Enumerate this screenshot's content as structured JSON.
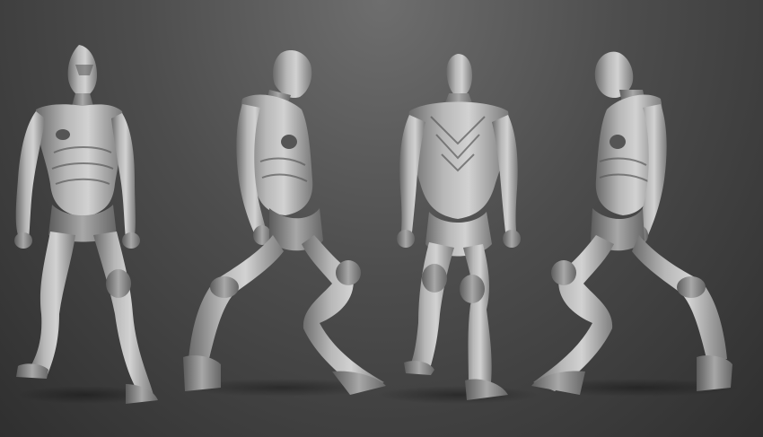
{
  "scene": {
    "background_top": "#6e6e6e",
    "background_bottom": "#2f2f2f",
    "material": "#a3a3a3",
    "material_highlight": "#d6d6d6",
    "material_shadow": "#5a5a5a"
  },
  "figures": [
    {
      "view": "front"
    },
    {
      "view": "three-quarter-left"
    },
    {
      "view": "back"
    },
    {
      "view": "three-quarter-right"
    }
  ]
}
